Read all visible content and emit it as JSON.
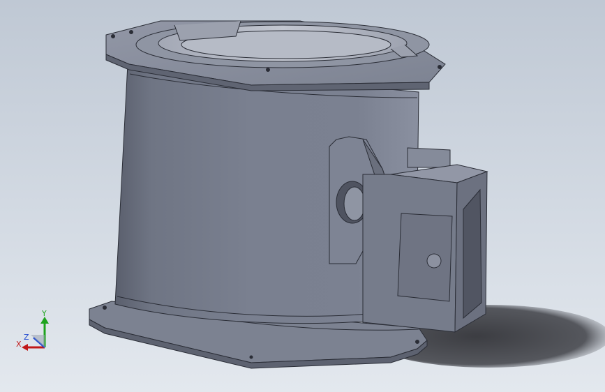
{
  "viewport": {
    "background_top": "#bfc8d4",
    "background_bottom": "#e3e8ee"
  },
  "model": {
    "body_color": "#747a8a",
    "edge_color": "#2a2d36",
    "shadow_color": "#4a4c52"
  },
  "triad": {
    "x_label": "X",
    "y_label": "Y",
    "z_label": "Z",
    "x_color": "#c01818",
    "y_color": "#1ea31e",
    "z_color": "#2048d0"
  }
}
